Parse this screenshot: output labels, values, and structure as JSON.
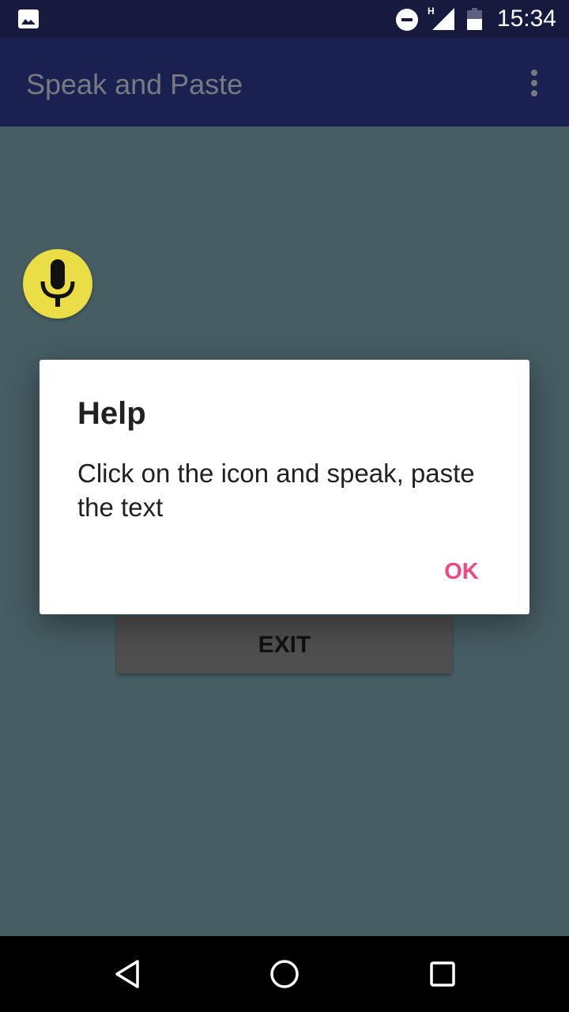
{
  "status_bar": {
    "time": "15:34",
    "network_type": "H",
    "icons": [
      "gallery-notification-icon",
      "do-not-disturb-icon",
      "signal-icon",
      "battery-icon"
    ]
  },
  "app_bar": {
    "title": "Speak and Paste",
    "overflow_icon": "more-vert-icon"
  },
  "main": {
    "mic_icon": "microphone-icon",
    "exit_label": "EXIT"
  },
  "dialog": {
    "title": "Help",
    "message": "Click on the icon and speak, paste the text",
    "ok_label": "OK"
  },
  "nav_bar": {
    "buttons": [
      "back",
      "home",
      "recents"
    ]
  },
  "colors": {
    "status_bar": "#161a3f",
    "app_bar": "#1a2150",
    "content_scrim": "#465d64",
    "mic_button": "#ebdd45",
    "dialog_accent": "#f04882"
  }
}
